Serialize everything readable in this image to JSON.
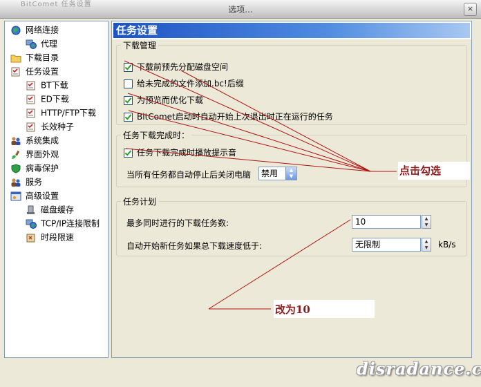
{
  "window": {
    "title": "选项...",
    "faded_title": "BitComet 任务设置",
    "close_glyph": "×"
  },
  "tree": [
    {
      "label": "网络连接",
      "level": 0,
      "icon": "globe-icon"
    },
    {
      "label": "代理",
      "level": 1,
      "icon": "network-globe-icon"
    },
    {
      "label": "下载目录",
      "level": 0,
      "icon": "folder-icon"
    },
    {
      "label": "任务设置",
      "level": 0,
      "icon": "checklist-icon"
    },
    {
      "label": "BT下载",
      "level": 1,
      "icon": "checklist-icon"
    },
    {
      "label": "ED下载",
      "level": 1,
      "icon": "checklist-icon"
    },
    {
      "label": "HTTP/FTP下载",
      "level": 1,
      "icon": "checklist-icon"
    },
    {
      "label": "长效种子",
      "level": 1,
      "icon": "checklist-icon"
    },
    {
      "label": "系统集成",
      "level": 0,
      "icon": "users-icon"
    },
    {
      "label": "界面外观",
      "level": 0,
      "icon": "brush-icon"
    },
    {
      "label": "病毒保护",
      "level": 0,
      "icon": "shield-icon"
    },
    {
      "label": "服务",
      "level": 0,
      "icon": "users-icon"
    },
    {
      "label": "高级设置",
      "level": 0,
      "icon": "settings-window-icon"
    },
    {
      "label": "磁盘缓存",
      "level": 1,
      "icon": "disk-icon"
    },
    {
      "label": "TCP/IP连接限制",
      "level": 1,
      "icon": "network-globe-icon"
    },
    {
      "label": "时段限速",
      "level": 1,
      "icon": "clock-icon"
    }
  ],
  "panel": {
    "title": "任务设置",
    "download_mgmt": {
      "legend": "下载管理",
      "options": [
        {
          "label": "下载前预先分配磁盘空间",
          "checked": true
        },
        {
          "label": "给未完成的文件添加.bc!后缀",
          "checked": false
        },
        {
          "label": "为预览而优化下载",
          "checked": true
        },
        {
          "label": "BitComet启动时自动开始上次退出时正在运行的任务",
          "checked": true
        }
      ]
    },
    "on_complete": {
      "legend": "任务下载完成时：",
      "play_sound_label": "任务下载完成时播放提示音",
      "play_sound_checked": true,
      "shutdown_label": "当所有任务都自动停止后关闭电脑",
      "shutdown_value": "禁用"
    },
    "schedule": {
      "legend": "任务计划",
      "max_tasks_label": "最多同时进行的下载任务数:",
      "max_tasks_value": "10",
      "auto_start_label": "自动开始新任务如果总下载速度低于:",
      "auto_start_value": "无限制",
      "auto_start_unit": "kB/s"
    }
  },
  "annotations": {
    "check_note": "点击勾选",
    "change_note": "改为10",
    "line_color": "#b01010"
  },
  "watermark": "disradance.cn"
}
